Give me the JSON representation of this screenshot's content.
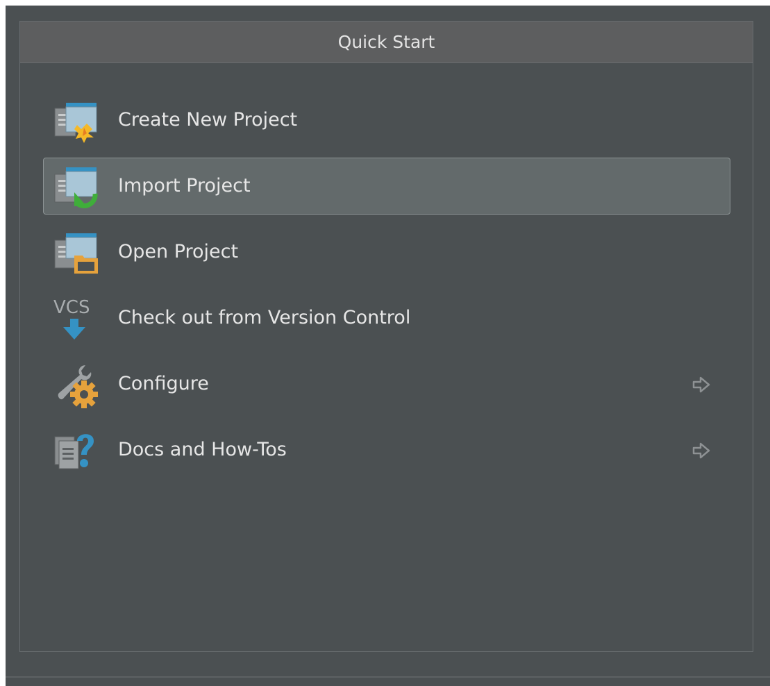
{
  "panel": {
    "title": "Quick Start"
  },
  "actions": [
    {
      "label": "Create New Project",
      "icon": "create-new-project-icon",
      "has_submenu": false,
      "selected": false
    },
    {
      "label": "Import Project",
      "icon": "import-project-icon",
      "has_submenu": false,
      "selected": true
    },
    {
      "label": "Open Project",
      "icon": "open-project-icon",
      "has_submenu": false,
      "selected": false
    },
    {
      "label": "Check out from Version Control",
      "icon": "vcs-checkout-icon",
      "has_submenu": false,
      "selected": false,
      "icon_text": "VCS"
    },
    {
      "label": "Configure",
      "icon": "configure-icon",
      "has_submenu": true,
      "selected": false
    },
    {
      "label": "Docs and How-Tos",
      "icon": "docs-icon",
      "has_submenu": true,
      "selected": false
    }
  ],
  "colors": {
    "background": "#4b5052",
    "header": "#5d5e5f",
    "selection": "#636a6b",
    "text": "#e6e6e6",
    "accent_blue": "#3592c4",
    "accent_orange": "#e6a23c",
    "accent_green": "#3fae3a"
  }
}
